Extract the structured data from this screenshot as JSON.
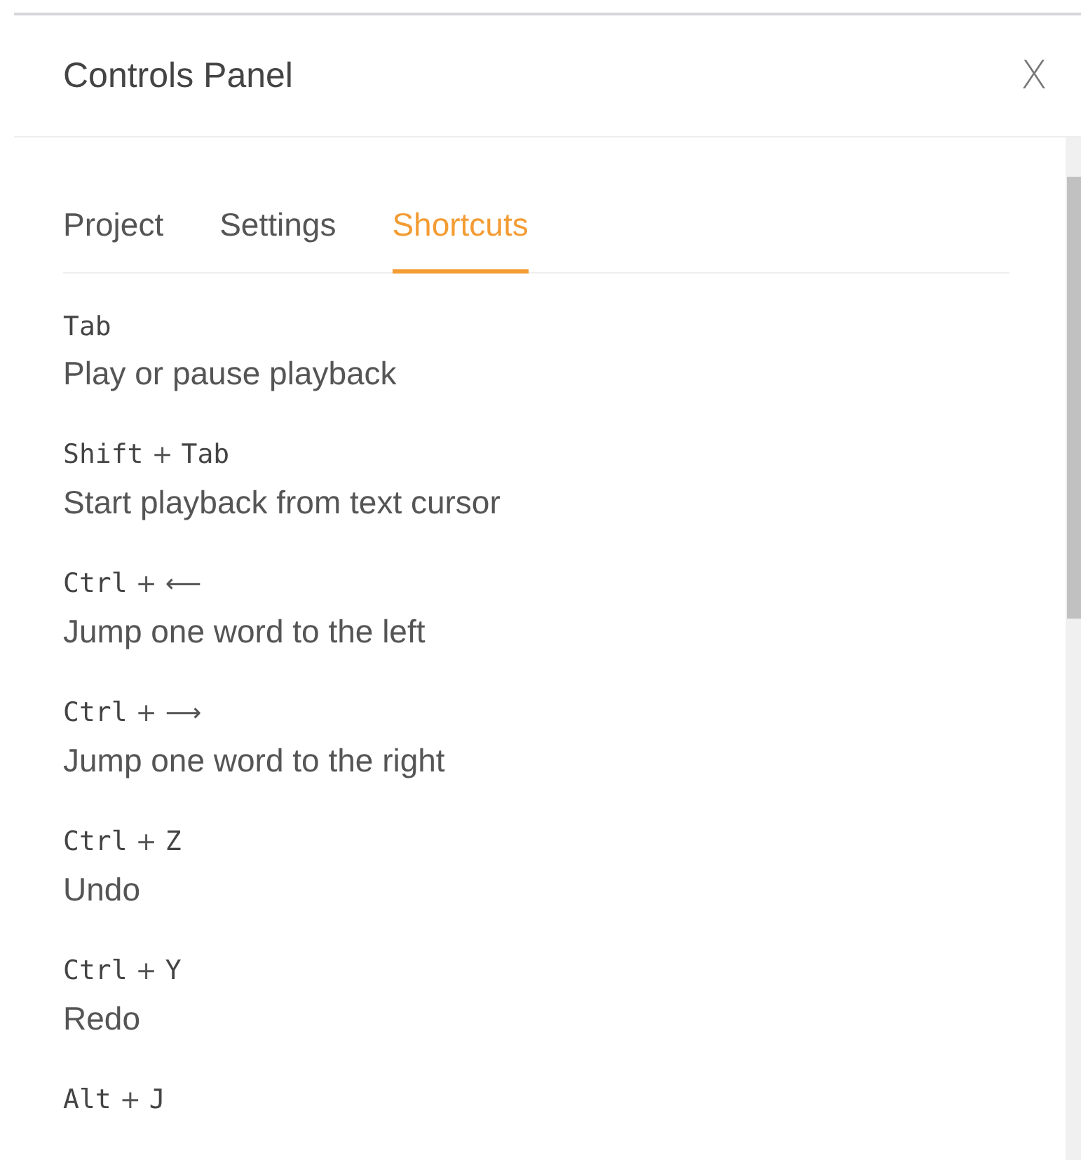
{
  "panel": {
    "title": "Controls Panel",
    "close": "X"
  },
  "tabs": [
    {
      "label": "Project",
      "selected": false
    },
    {
      "label": "Settings",
      "selected": false
    },
    {
      "label": "Shortcuts",
      "selected": true
    }
  ],
  "shortcuts": [
    {
      "keys": [
        {
          "kind": "key",
          "text": "Tab"
        }
      ],
      "description": "Play or pause playback"
    },
    {
      "keys": [
        {
          "kind": "key",
          "text": "Shift"
        },
        {
          "kind": "plus",
          "text": "+"
        },
        {
          "kind": "key",
          "text": "Tab"
        }
      ],
      "description": "Start playback from text cursor"
    },
    {
      "keys": [
        {
          "kind": "key",
          "text": "Ctrl"
        },
        {
          "kind": "plus",
          "text": "+"
        },
        {
          "kind": "symbol",
          "text": "⟵"
        }
      ],
      "description": "Jump one word to the left"
    },
    {
      "keys": [
        {
          "kind": "key",
          "text": "Ctrl"
        },
        {
          "kind": "plus",
          "text": "+"
        },
        {
          "kind": "symbol",
          "text": "⟶"
        }
      ],
      "description": "Jump one word to the right"
    },
    {
      "keys": [
        {
          "kind": "key",
          "text": "Ctrl"
        },
        {
          "kind": "plus",
          "text": "+"
        },
        {
          "kind": "key",
          "text": "Z"
        }
      ],
      "description": "Undo"
    },
    {
      "keys": [
        {
          "kind": "key",
          "text": "Ctrl"
        },
        {
          "kind": "plus",
          "text": "+"
        },
        {
          "kind": "key",
          "text": "Y"
        }
      ],
      "description": "Redo"
    },
    {
      "keys": [
        {
          "kind": "key",
          "text": "Alt"
        },
        {
          "kind": "plus",
          "text": "+"
        },
        {
          "kind": "key",
          "text": "J"
        }
      ]
    }
  ]
}
